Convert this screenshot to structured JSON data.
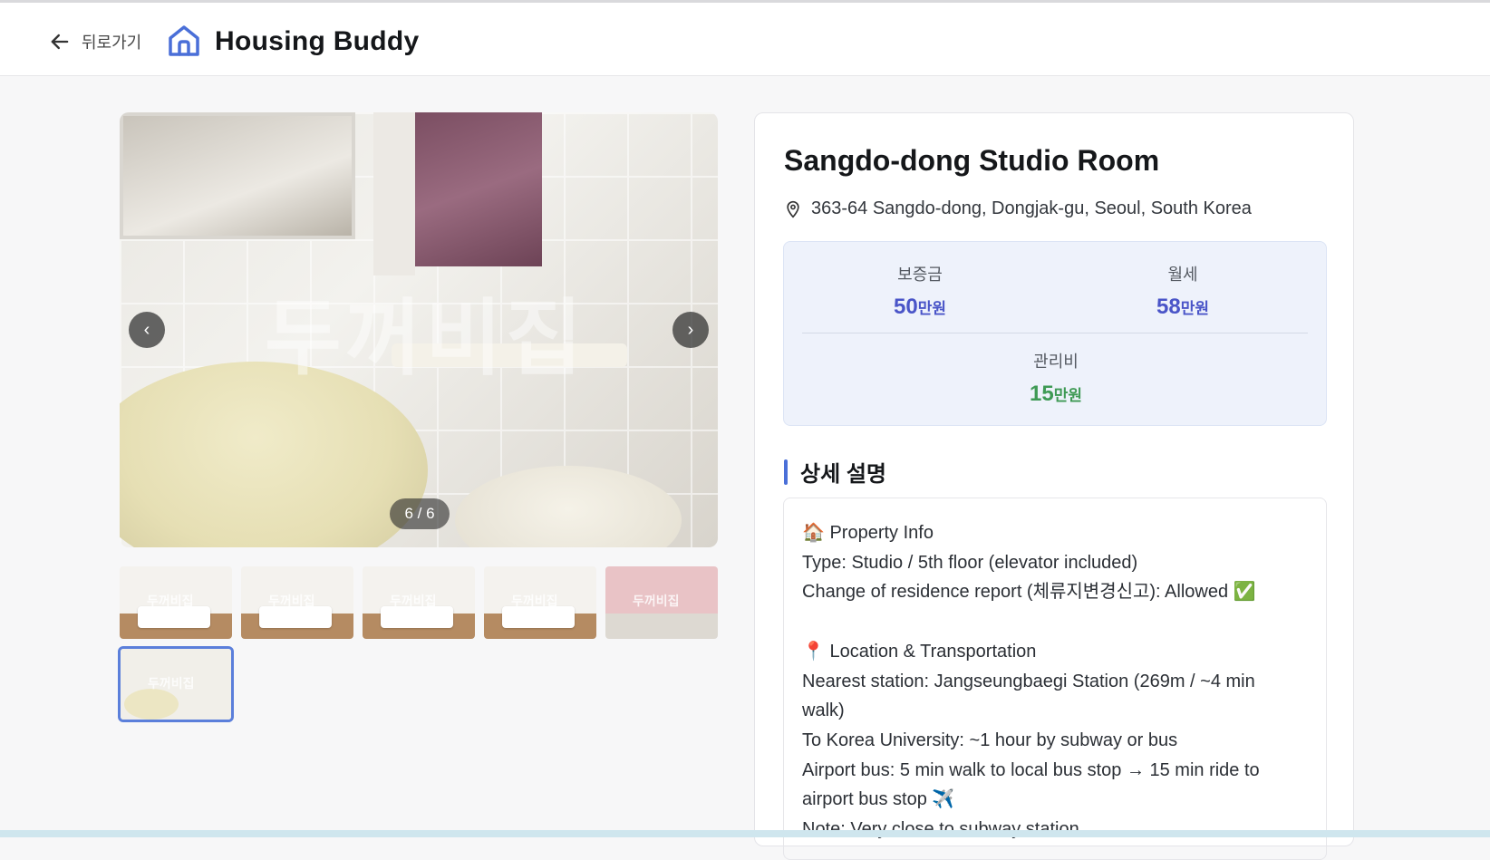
{
  "header": {
    "back_label": "뒤로가기",
    "app_title": "Housing Buddy"
  },
  "gallery": {
    "watermark": "두꺼비집",
    "counter": "6 / 6",
    "prev_icon": "chevron-left-icon",
    "next_icon": "chevron-right-icon",
    "thumb_watermark": "두꺼비집",
    "total_photos": 6,
    "current_photo": 6
  },
  "listing": {
    "title": "Sangdo-dong Studio Room",
    "address": "363-64 Sangdo-dong, Dongjak-gu, Seoul, South Korea",
    "prices": {
      "deposit": {
        "label": "보증금",
        "value": "50",
        "unit": "만원",
        "color": "#4a55c8"
      },
      "monthly": {
        "label": "월세",
        "value": "58",
        "unit": "만원",
        "color": "#4a55c8"
      },
      "maintenance": {
        "label": "관리비",
        "value": "15",
        "unit": "만원",
        "color": "#3f9a55"
      }
    },
    "section_title": "상세 설명",
    "description": [
      "🏠 Property Info",
      "Type: Studio / 5th floor (elevator included)",
      "Change of residence report (체류지변경신고): Allowed ✅",
      "",
      "📍 Location & Transportation",
      "Nearest station: Jangseungbaegi Station (269m / ~4 min",
      "walk)",
      "To Korea University: ~1 hour by subway or bus",
      "Airport bus: 5 min walk to local bus stop → 15 min ride to",
      "airport bus stop ✈️",
      "Note: Very close to subway station"
    ]
  },
  "colors": {
    "accent": "#4a6fd8",
    "price_blue": "#4a55c8",
    "price_green": "#3f9a55"
  }
}
